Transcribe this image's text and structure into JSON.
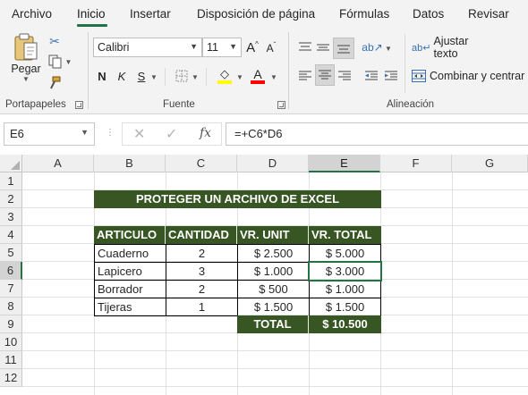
{
  "tabs": [
    "Archivo",
    "Inicio",
    "Insertar",
    "Disposición de página",
    "Fórmulas",
    "Datos",
    "Revisar"
  ],
  "active_tab": "Inicio",
  "ribbon": {
    "clipboard": {
      "label": "Portapapeles",
      "paste": "Pegar"
    },
    "font": {
      "label": "Fuente",
      "name": "Calibri",
      "size": "11",
      "bold": "N",
      "italic": "K",
      "underline": "S",
      "fill_color": "#FFFF00",
      "font_color": "#FF0000"
    },
    "alignment": {
      "label": "Alineación",
      "wrap_text": "Ajustar texto",
      "merge_center": "Combinar y centrar"
    }
  },
  "formula_bar": {
    "name_box": "E6",
    "fx": "fx",
    "formula": "=+C6*D6"
  },
  "sheet": {
    "columns": [
      "A",
      "B",
      "C",
      "D",
      "E",
      "F",
      "G"
    ],
    "rows": [
      "1",
      "2",
      "3",
      "4",
      "5",
      "6",
      "7",
      "8",
      "9",
      "10",
      "11",
      "12"
    ],
    "selected_cell": "E6",
    "title": "PROTEGER UN ARCHIVO DE EXCEL",
    "headers": [
      "ARTICULO",
      "CANTIDAD",
      "VR. UNIT",
      "VR. TOTAL"
    ],
    "items": [
      {
        "articulo": "Cuaderno",
        "cantidad": "2",
        "vr_unit": "$ 2.500",
        "vr_total": "$ 5.000"
      },
      {
        "articulo": "Lapicero",
        "cantidad": "3",
        "vr_unit": "$ 1.000",
        "vr_total": "$ 3.000"
      },
      {
        "articulo": "Borrador",
        "cantidad": "2",
        "vr_unit": "$ 500",
        "vr_total": "$ 1.000"
      },
      {
        "articulo": "Tijeras",
        "cantidad": "1",
        "vr_unit": "$ 1.500",
        "vr_total": "$ 1.500"
      }
    ],
    "total_label": "TOTAL",
    "total_value": "$ 10.500",
    "header_fill_color": "#375623"
  }
}
